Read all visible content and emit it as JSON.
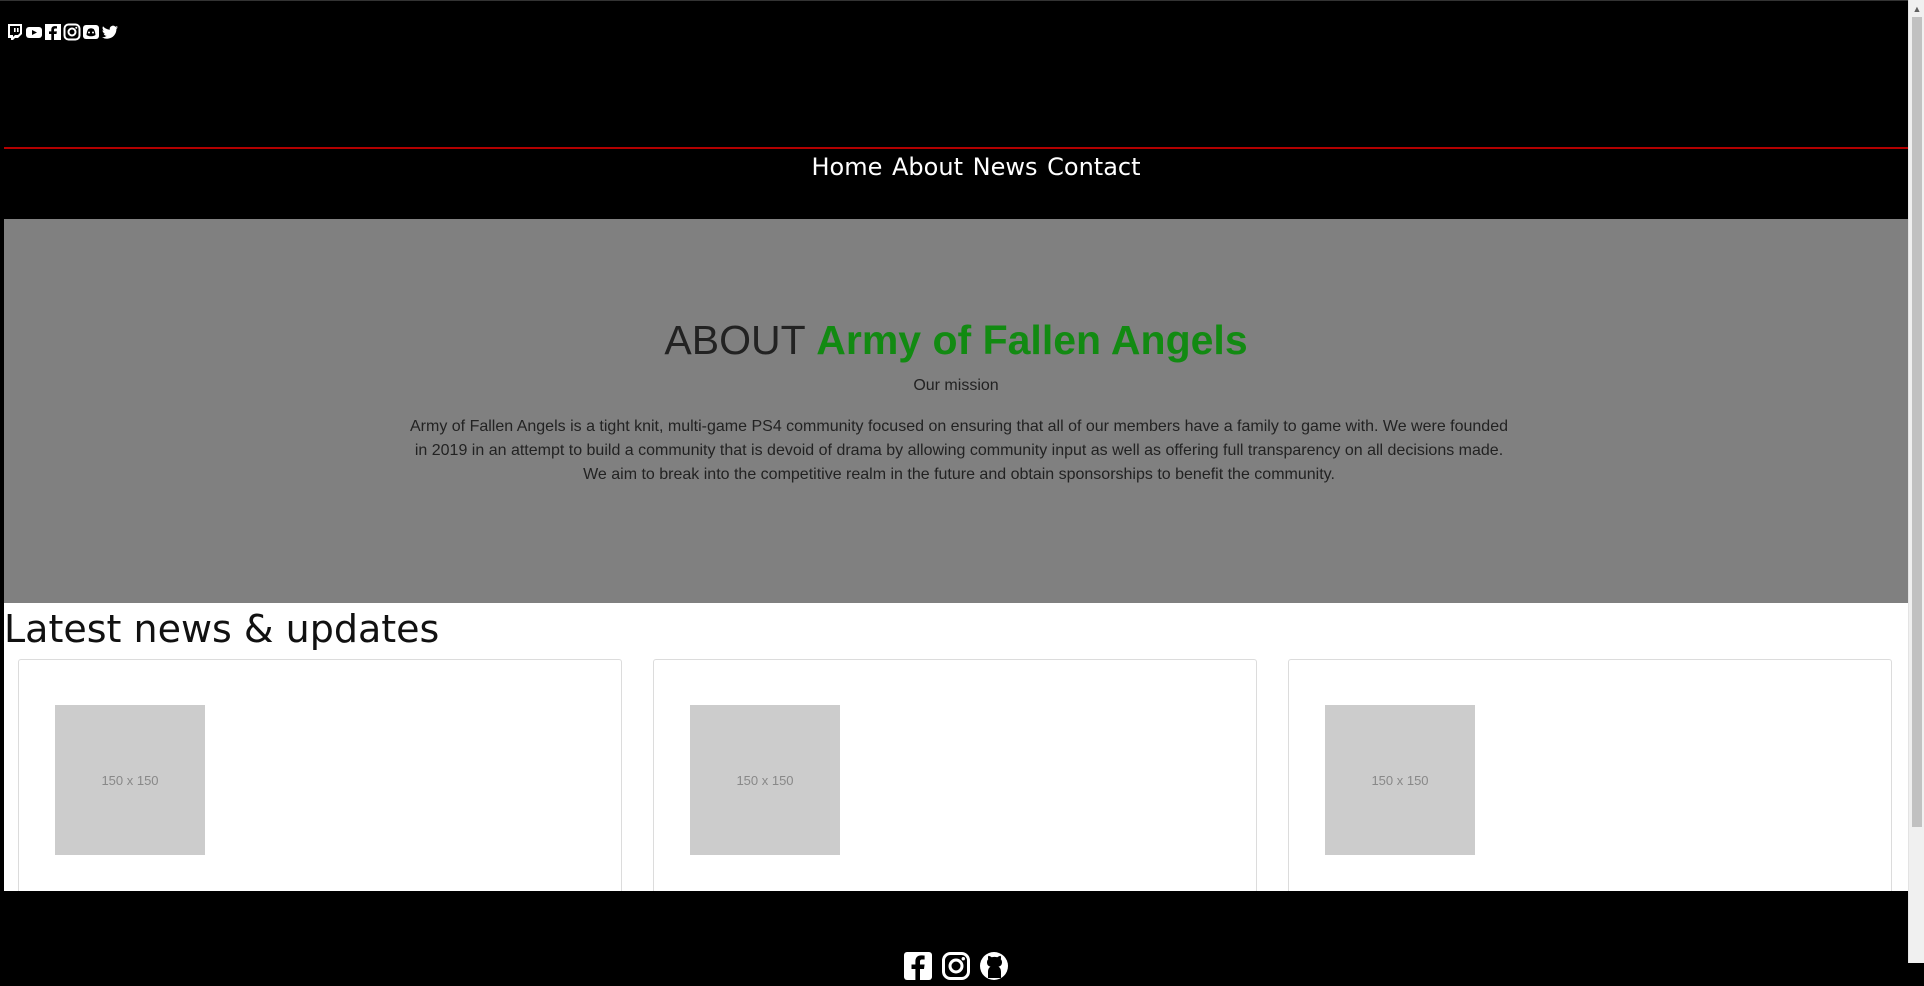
{
  "nav": {
    "items": [
      {
        "label": "Home"
      },
      {
        "label": "About"
      },
      {
        "label": "News"
      },
      {
        "label": "Contact"
      }
    ]
  },
  "social_top": [
    "twitch-icon",
    "youtube-icon",
    "facebook-icon",
    "instagram-icon",
    "discord-icon",
    "twitter-icon"
  ],
  "about": {
    "title_prefix": "ABOUT",
    "title_brand": "Army of Fallen Angels",
    "subtitle": "Our mission",
    "text": "Army of Fallen Angels is a tight knit, multi-game PS4 community focused on ensuring that all of our members have a family to game with. We were founded in 2019 in an attempt to build a community that is devoid of drama by allowing community input as well as offering full transparency on all decisions made. We aim to break into the competitive realm in the future and obtain sponsorships to benefit the community."
  },
  "news": {
    "heading": "Latest news & updates",
    "cards": [
      {
        "thumb_label": "150 x 150"
      },
      {
        "thumb_label": "150 x 150"
      },
      {
        "thumb_label": "150 x 150"
      }
    ]
  },
  "footer_icons": [
    "facebook-icon",
    "instagram-icon",
    "github-icon"
  ],
  "colors": {
    "brand": "#128a12",
    "divider": "#b30000",
    "about_bg": "#808080"
  }
}
